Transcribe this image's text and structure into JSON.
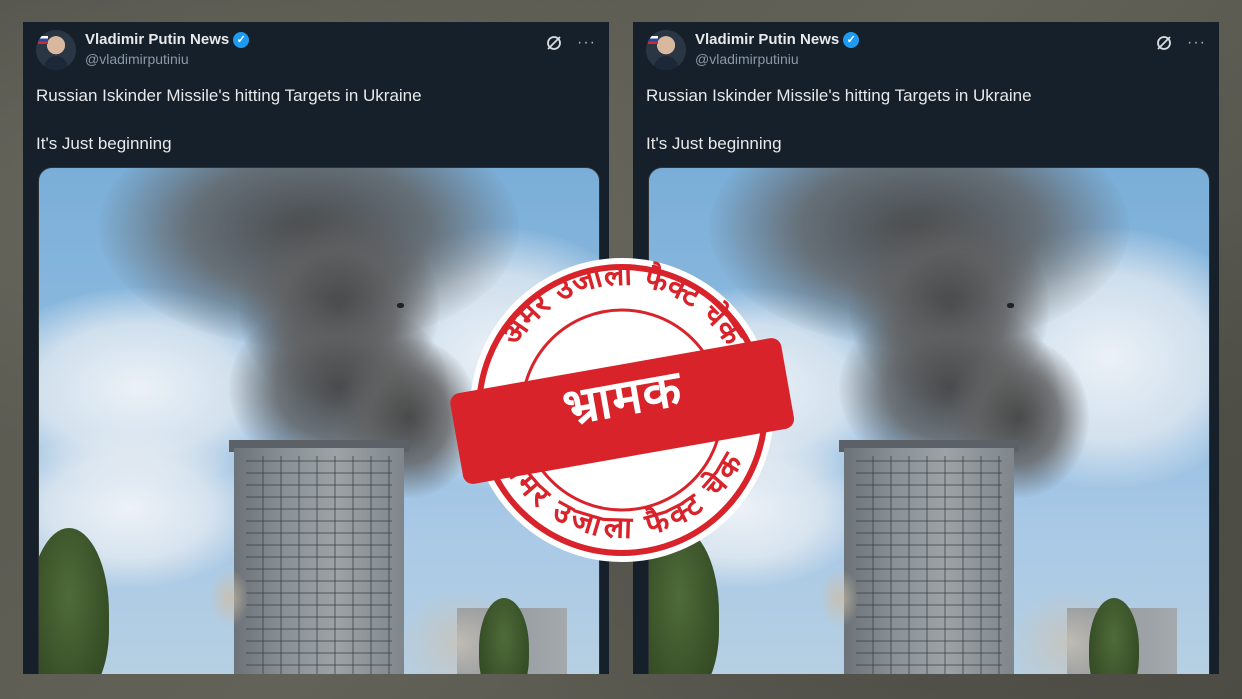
{
  "tweets": [
    {
      "author_name": "Vladimir Putin News",
      "handle": "@vladimirputiniu",
      "line1": "Russian Iskinder Missile's hitting Targets in Ukraine",
      "line2": "It's Just beginning",
      "verified_icon": "verified-badge-icon",
      "grok_icon": "grok-icon",
      "more_icon": "more-icon"
    },
    {
      "author_name": "Vladimir Putin News",
      "handle": "@vladimirputiniu",
      "line1": "Russian Iskinder Missile's hitting Targets in Ukraine",
      "line2": "It's Just beginning",
      "verified_icon": "verified-badge-icon",
      "grok_icon": "grok-icon",
      "more_icon": "more-icon"
    }
  ],
  "stamp": {
    "verdict": "भ्रामक",
    "ring_text_top": "अमर उजाला फैक्ट चेक",
    "ring_text_bottom": "अमर उजाला फैक्ट चेक",
    "color": "#d8232a"
  },
  "colors": {
    "card_bg": "#15202b",
    "text": "#e7e9ea",
    "secondary_text": "#8b98a5",
    "verified": "#1d9bf0"
  }
}
